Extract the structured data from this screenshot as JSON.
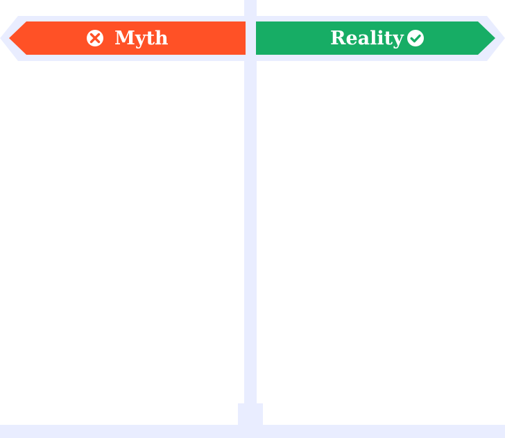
{
  "colors": {
    "post": "#e9edff",
    "myth": "#ff5126",
    "reality": "#17ad65",
    "text": "#ffffff"
  },
  "myth_sign": {
    "label": "Myth",
    "icon": "x-circle-icon"
  },
  "reality_sign": {
    "label": "Reality",
    "icon": "check-circle-icon"
  }
}
